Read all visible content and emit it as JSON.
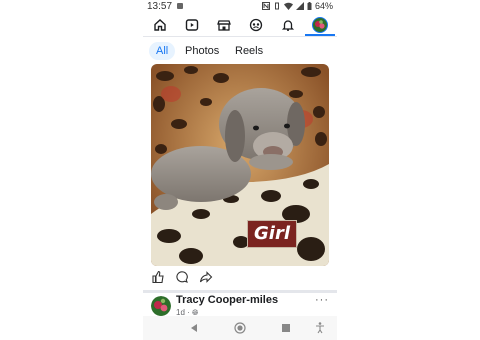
{
  "status_bar": {
    "time": "13:57",
    "battery": "64%"
  },
  "top_nav": {
    "items": [
      "home-icon",
      "video-icon",
      "marketplace-icon",
      "groups-icon",
      "notifications-icon",
      "profile-avatar"
    ],
    "active": "profile-avatar"
  },
  "tabs": [
    {
      "label": "All",
      "active": true
    },
    {
      "label": "Photos",
      "active": false
    },
    {
      "label": "Reels",
      "active": false
    }
  ],
  "photo": {
    "caption": "Girl",
    "caption_bg": "#7b2420"
  },
  "post_actions": [
    "like-icon",
    "comment-icon",
    "share-icon"
  ],
  "next_post": {
    "author": "Tracy Cooper-miles",
    "meta": "1d · ",
    "more": "···"
  },
  "colors": {
    "accent": "#1877f2"
  }
}
